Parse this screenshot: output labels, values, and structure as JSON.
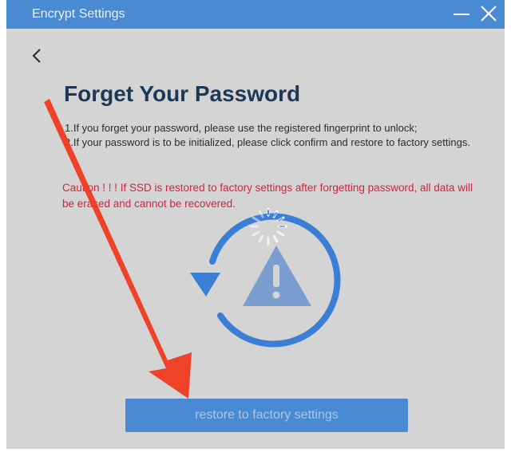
{
  "window": {
    "title": "Encrypt Settings"
  },
  "icons": {
    "minimize": "minimize-icon",
    "close": "close-icon",
    "back": "chevron-left-icon",
    "restore": "restore-warning-icon",
    "loading": "loading-spinner-icon",
    "arrow": "red-arrow-annotation"
  },
  "page": {
    "heading": "Forget Your Password",
    "instruction_1": "1.If you forget your password, please use the registered fingerprint to unlock;",
    "instruction_2": "2.If your password is to be initialized, please click confirm and restore to factory settings.",
    "caution": "Caution ! ! !  If SSD is restored to factory settings after forgetting password, all data will be erased and cannot be recovered."
  },
  "actions": {
    "restore_label": "restore to factory settings"
  },
  "colors": {
    "titlebar": "#4a8ad2",
    "background": "#d4d4d4",
    "heading": "#1f3756",
    "caution": "#d2233f",
    "accent": "#4a8ad2",
    "arrow": "#f03a1f"
  }
}
